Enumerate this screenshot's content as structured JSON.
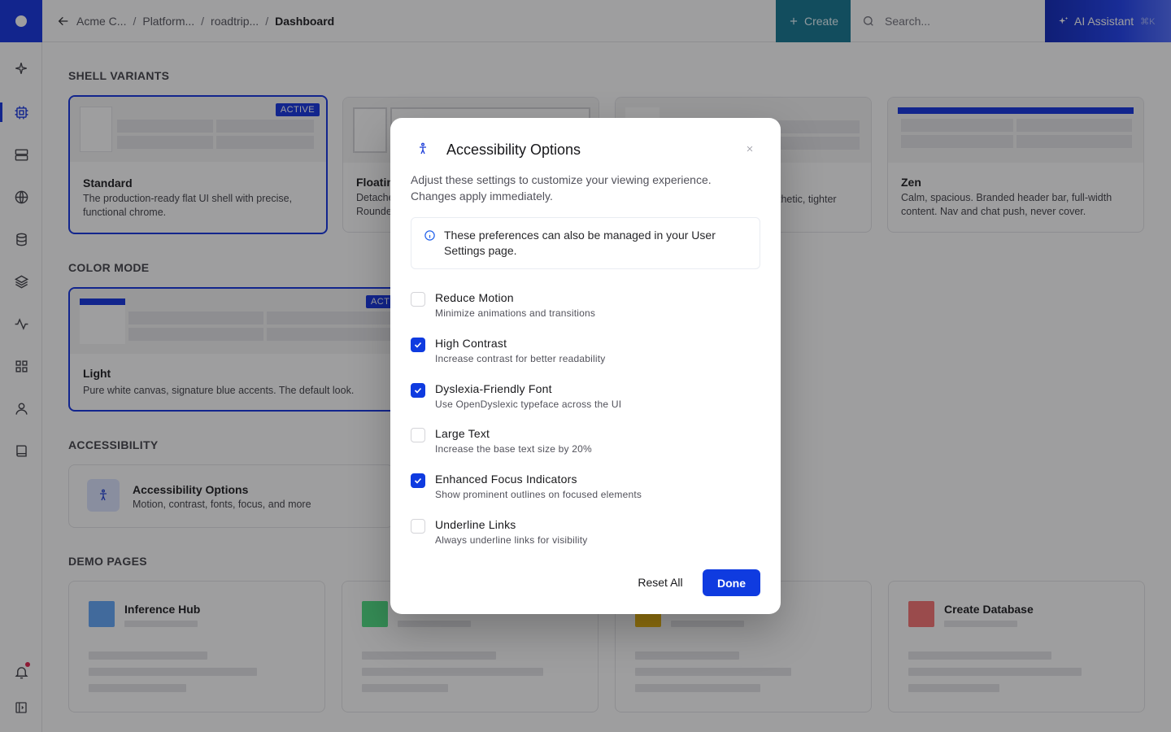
{
  "topbar": {
    "breadcrumbs": [
      "Acme C...",
      "Platform...",
      "roadtrip...",
      "Dashboard"
    ],
    "create_label": "Create",
    "search_placeholder": "Search...",
    "ai_label": "AI Assistant",
    "ai_shortcut": "⌘K"
  },
  "sections": {
    "shell_variants": "SHELL VARIANTS",
    "color_mode": "COLOR MODE",
    "accessibility": "ACCESSIBILITY",
    "demo_pages": "DEMO PAGES"
  },
  "shell_cards": [
    {
      "title": "Standard",
      "desc": "The production-ready flat UI shell with precise, functional chrome.",
      "badge": "ACTIVE",
      "active": true
    },
    {
      "title": "Floatin",
      "desc": "Detache\nRounde",
      "active": false
    },
    {
      "title": "",
      "desc": "thetic, tighter",
      "active": false
    },
    {
      "title": "Zen",
      "desc": "Calm, spacious. Branded header bar, full-width content. Nav and chat push, never cover.",
      "active": false
    }
  ],
  "color_cards": [
    {
      "title": "Light",
      "desc": "Pure white canvas, signature blue accents. The default look.",
      "badge": "ACT",
      "active": true
    }
  ],
  "accessibility_card": {
    "title": "Accessibility Options",
    "desc": "Motion, contrast, fonts, focus, and more"
  },
  "demo_pages": [
    {
      "title": "Inference Hub",
      "swatch": "#60a5fa"
    },
    {
      "title": "",
      "swatch": "#4ade80"
    },
    {
      "title": "",
      "swatch": "#eab308"
    },
    {
      "title": "Create Database",
      "swatch": "#f87171"
    }
  ],
  "modal": {
    "title": "Accessibility Options",
    "description": "Adjust these settings to customize your viewing experience. Changes apply immediately.",
    "info": "These preferences can also be managed in your User Settings page.",
    "options": [
      {
        "label": "Reduce Motion",
        "hint": "Minimize animations and transitions",
        "checked": false
      },
      {
        "label": "High Contrast",
        "hint": "Increase contrast for better readability",
        "checked": true
      },
      {
        "label": "Dyslexia-Friendly Font",
        "hint": "Use OpenDyslexic typeface across the UI",
        "checked": true
      },
      {
        "label": "Large Text",
        "hint": "Increase the base text size by 20%",
        "checked": false
      },
      {
        "label": "Enhanced Focus Indicators",
        "hint": "Show prominent outlines on focused elements",
        "checked": true
      },
      {
        "label": "Underline Links",
        "hint": "Always underline links for visibility",
        "checked": false
      }
    ],
    "reset_label": "Reset All",
    "done_label": "Done"
  },
  "colors": {
    "brand": "#0f2fe0",
    "create": "#0e7490",
    "checkbox_on": "#0f3be0"
  },
  "rail_icons": [
    "sparkle-icon",
    "cpu-icon",
    "server-icon",
    "globe-icon",
    "database-icon",
    "layers-icon",
    "activity-icon",
    "grid-icon",
    "user-icon",
    "book-icon",
    "bell-icon",
    "panel-toggle-icon"
  ]
}
